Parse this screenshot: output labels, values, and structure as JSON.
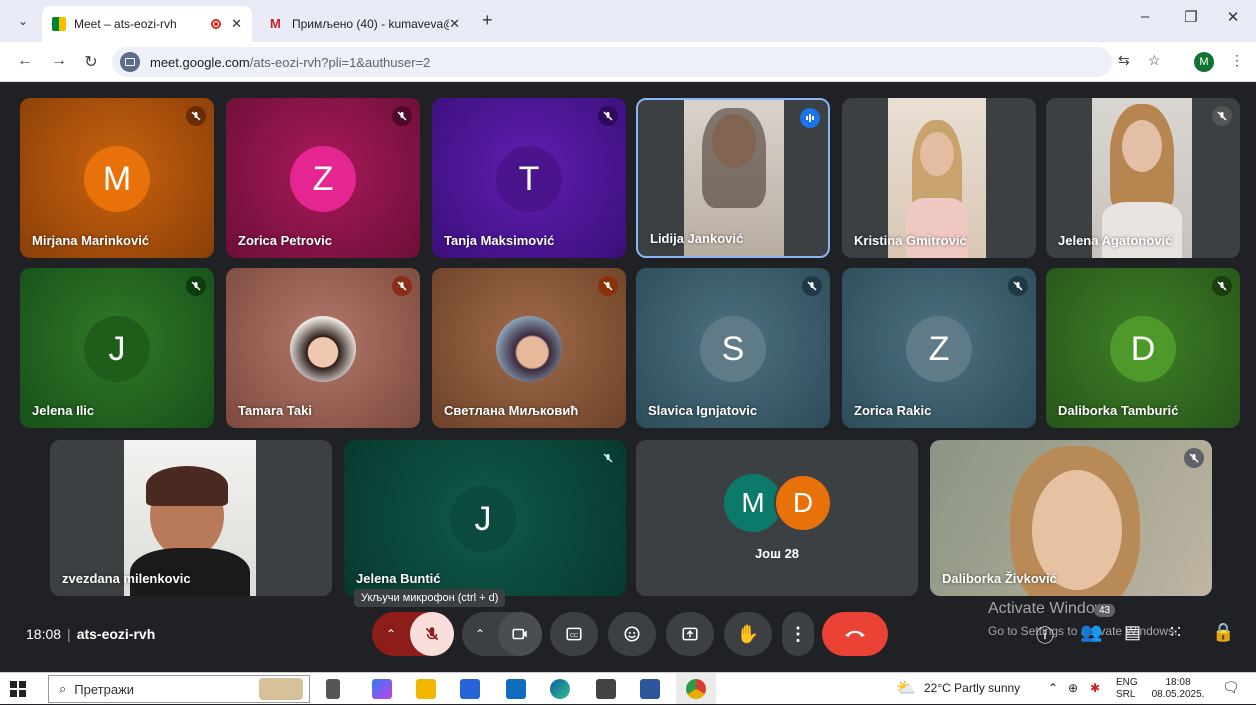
{
  "browser": {
    "tabs": [
      {
        "title": "Meet – ats-eozi-rvh",
        "active": true
      },
      {
        "title": "Примљено (40) - kumaveva@g",
        "active": false
      }
    ],
    "url_host": "meet.google.com",
    "url_path": "/ats-eozi-rvh?pli=1&authuser=2",
    "profile_initial": "M"
  },
  "participants": [
    {
      "name": "Mirjana Marinković",
      "initial": "M"
    },
    {
      "name": "Zorica Petrovic",
      "initial": "Z"
    },
    {
      "name": "Tanja Maksimović",
      "initial": "T"
    },
    {
      "name": "Lidija Janković"
    },
    {
      "name": "Kristina Gmitrović"
    },
    {
      "name": "Jelena Agatonović"
    },
    {
      "name": "Jelena Ilic",
      "initial": "J"
    },
    {
      "name": "Tamara Taki"
    },
    {
      "name": "Светлана Миљковић"
    },
    {
      "name": "Slavica Ignjatovic",
      "initial": "S"
    },
    {
      "name": "Zorica Rakic",
      "initial": "Z"
    },
    {
      "name": "Daliborka Tamburić",
      "initial": "D"
    },
    {
      "name": "zvezdana milenkovic"
    },
    {
      "name": "Jelena Buntić",
      "initial": "J"
    },
    {
      "name": "Daliborka Živković"
    }
  ],
  "others": {
    "label": "Још 28",
    "initials": [
      "M",
      "D"
    ]
  },
  "meeting": {
    "time": "18:08",
    "code": "ats-eozi-rvh"
  },
  "tooltip": "Укључи микрофон (ctrl + d)",
  "watermark": {
    "title": "Activate Windows",
    "subtitle": "Go to Settings to activate Windows."
  },
  "people_count": "43",
  "taskbar": {
    "search_placeholder": "Претражи",
    "weather": "22°C  Partly sunny",
    "lang": "ENG",
    "layout": "SRL",
    "time": "18:08",
    "date": "08.05.2025."
  }
}
